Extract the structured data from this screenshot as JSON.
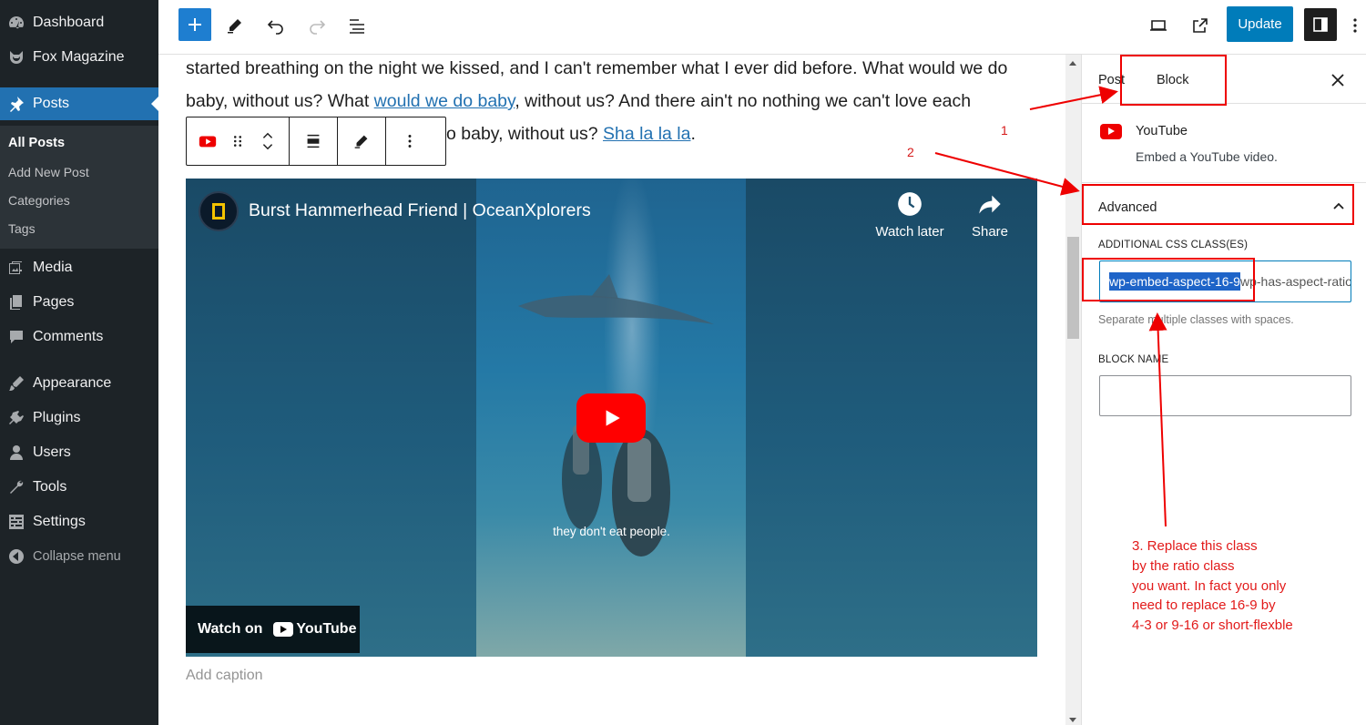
{
  "admin_menu": {
    "items": [
      {
        "label": "Dashboard",
        "icon": "dashboard-icon"
      },
      {
        "label": "Fox Magazine",
        "icon": "fox-icon"
      },
      {
        "label": "Posts",
        "icon": "pin-icon"
      },
      {
        "label": "Media",
        "icon": "media-icon"
      },
      {
        "label": "Pages",
        "icon": "pages-icon"
      },
      {
        "label": "Comments",
        "icon": "comments-icon"
      },
      {
        "label": "Appearance",
        "icon": "appearance-icon"
      },
      {
        "label": "Plugins",
        "icon": "plugins-icon"
      },
      {
        "label": "Users",
        "icon": "users-icon"
      },
      {
        "label": "Tools",
        "icon": "tools-icon"
      },
      {
        "label": "Settings",
        "icon": "settings-icon"
      }
    ],
    "submenu": [
      "All Posts",
      "Add New Post",
      "Categories",
      "Tags"
    ],
    "collapse_label": "Collapse menu"
  },
  "top_toolbar": {
    "update_label": "Update"
  },
  "editor": {
    "line1": "started breathing on the night we kissed, and I can't remember what I ever did before. What would we do",
    "line2_before": "baby, without us? What ",
    "line2_link": "would we do baby",
    "line2_after": ", without us? And there ain't no nothing we can't love each",
    "line3_before": "o baby, without us? ",
    "line3_link": "Sha la la la",
    "line3_after": ".",
    "video": {
      "title": "Burst Hammerhead Friend | OceanXplorers",
      "watch_later": "Watch later",
      "share": "Share",
      "subtitle": "they don't eat people.",
      "watch_on": "Watch on",
      "youtube": "YouTube"
    },
    "caption_placeholder": "Add caption"
  },
  "settings": {
    "tab_post": "Post",
    "tab_block": "Block",
    "block_title": "YouTube",
    "block_desc": "Embed a YouTube video.",
    "advanced": "Advanced",
    "css_label": "ADDITIONAL CSS CLASS(ES)",
    "css_selected": "wp-embed-aspect-16-9",
    "css_rest": " wp-has-aspect-ratio",
    "css_help": "Separate multiple classes with spaces.",
    "name_label": "BLOCK NAME",
    "name_value": ""
  },
  "annotations": {
    "n1": "1",
    "n2": "2",
    "instruction_lines": [
      "3. Replace this class",
      "by the ratio class",
      "you want. In fact you only",
      "need to replace 16-9 by",
      "4-3 or 9-16 or short-flexble"
    ]
  },
  "colors": {
    "admin_bg": "#1d2327",
    "accent": "#2271b1",
    "annotation": "#e00000"
  }
}
